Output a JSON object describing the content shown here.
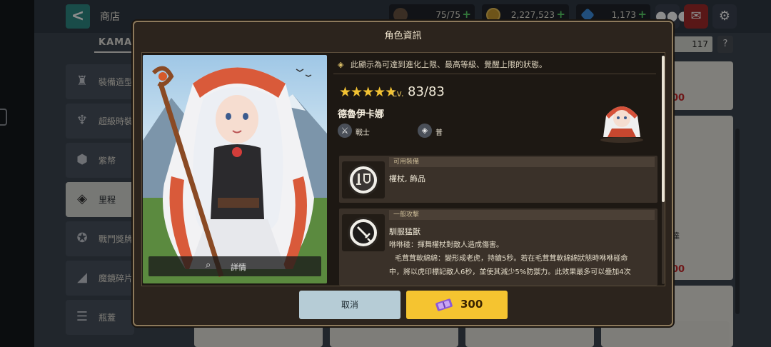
{
  "topbar": {
    "back_label": "<",
    "title": "商店",
    "stamina": "75/75",
    "gold": "2,227,523",
    "gems": "1,173",
    "plus": "+"
  },
  "tab": {
    "label": "KAMAZ"
  },
  "count": "117",
  "help": "?",
  "sidebar": {
    "items": [
      {
        "label": "裝備造型",
        "icon": "sword-statue-icon"
      },
      {
        "label": "超級時裝",
        "icon": "wings-icon"
      },
      {
        "label": "紫幣",
        "icon": "gear-coin-icon"
      },
      {
        "label": "里程",
        "icon": "ticket-icon",
        "active": true
      },
      {
        "label": "戰鬥獎牌",
        "icon": "medal-icon"
      },
      {
        "label": "魔鏡碎片",
        "icon": "shard-icon"
      },
      {
        "label": "瓶蓋",
        "icon": "bottlecap-icon"
      }
    ]
  },
  "right_cards": {
    "price1": "00",
    "price2": "00",
    "label": "達",
    "price3": "00"
  },
  "modal": {
    "title": "角色資訊",
    "notice": "此顯示為可達到進化上限、最高等級、覺醒上限的狀態。",
    "stars": "★★★★★",
    "lv_prefix": "Lv.",
    "level": "83/83",
    "name": "德魯伊卡娜",
    "class_label": "戰士",
    "attribute_label": "普",
    "detail_label": "詳情",
    "equip_section": {
      "header": "可用裝備",
      "text": "權杖, 飾品"
    },
    "attack_section": {
      "header": "一般攻擊",
      "title": "馴服猛獸",
      "desc_line1": "咻咻碰：揮舞權杖對敵人造成傷害。",
      "desc_line2": "毛茸茸軟綿綿：變形成老虎，持續5秒。若在毛茸茸軟綿綿狀態時咻咻碰命",
      "desc_line3": "中，將以虎印標記敵人6秒，並使其減少5%防禦力。此效果最多可以疊加4次",
      "desc_line4": "。"
    },
    "cancel_label": "取消",
    "buy_label": "300"
  },
  "colors": {
    "gold_accent": "#f5c430",
    "cancel_bg": "#b6ccd6",
    "modal_bg": "#2c241d",
    "price_red": "#c8292b"
  }
}
